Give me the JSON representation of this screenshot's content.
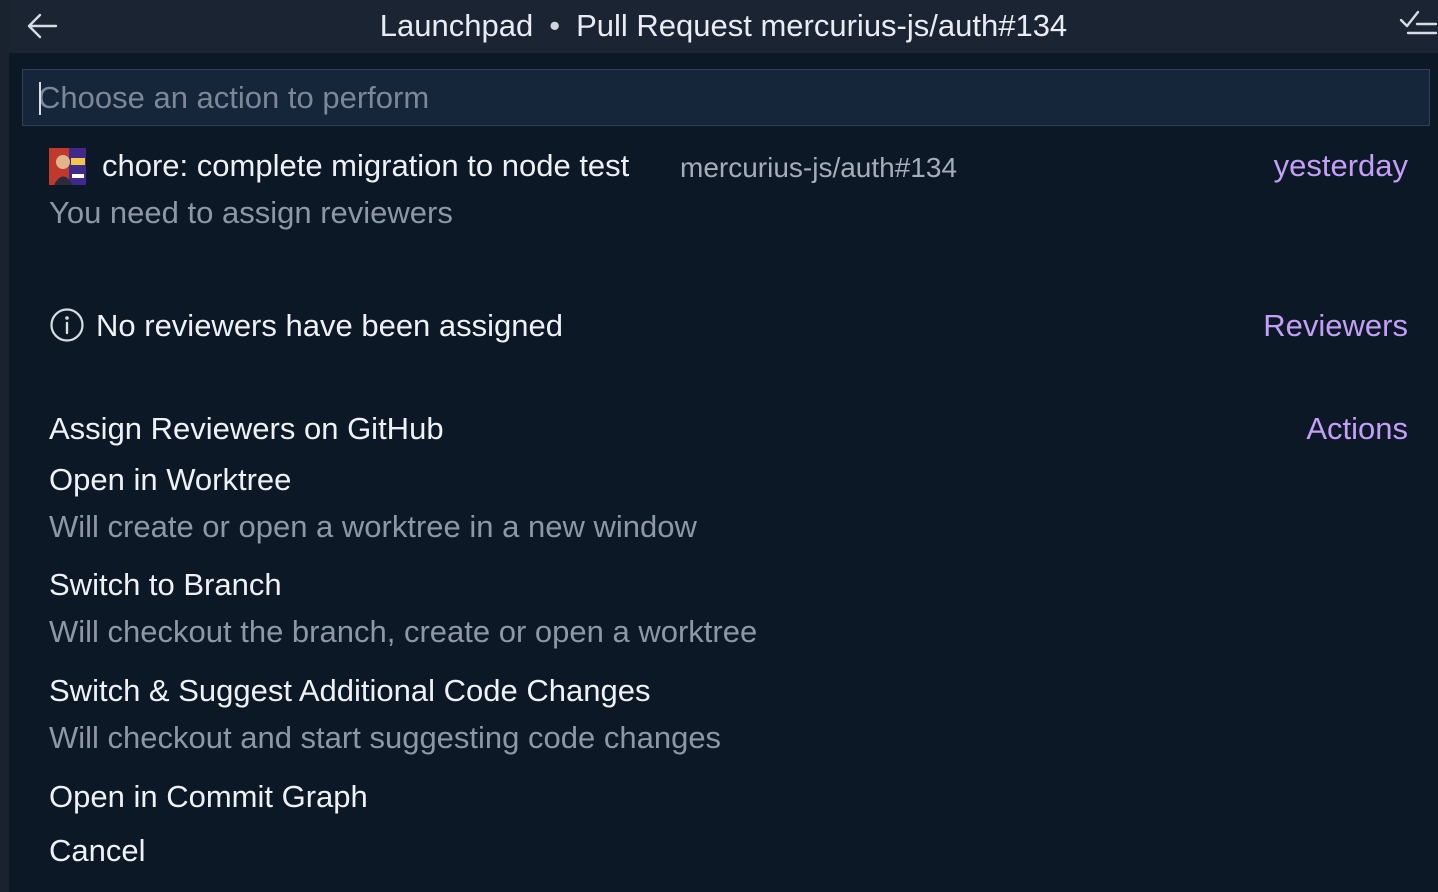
{
  "titlebar": {
    "title_left": "Launchpad",
    "separator": "•",
    "title_right": "Pull Request mercurius-js/auth#134",
    "back_icon": "arrow-left-icon",
    "right_icon": "check-all-icon"
  },
  "search": {
    "placeholder": "Choose an action to perform",
    "value": ""
  },
  "pull_request": {
    "title": "chore: complete migration to node test",
    "ref": "mercurius-js/auth#134",
    "time": "yesterday",
    "subtitle": "You need to assign reviewers",
    "avatar_icon": "user-avatar"
  },
  "info": {
    "icon": "info-circle-icon",
    "text": "No reviewers have been assigned",
    "tag": "Reviewers"
  },
  "actions": {
    "group_label": "Actions",
    "items": [
      {
        "title": "Assign Reviewers on GitHub",
        "subtitle": ""
      },
      {
        "title": "Open in Worktree",
        "subtitle": "Will create or open a worktree in a new window"
      },
      {
        "title": "Switch to Branch",
        "subtitle": "Will checkout the branch, create or open a worktree"
      },
      {
        "title": "Switch & Suggest Additional Code Changes",
        "subtitle": "Will checkout and start suggesting code changes"
      },
      {
        "title": "Open in Commit Graph",
        "subtitle": ""
      },
      {
        "title": "Cancel",
        "subtitle": ""
      }
    ]
  },
  "colors": {
    "background": "#0d1826",
    "titlebar": "#1b2433",
    "accent": "#c49ff7",
    "secondary_text": "#8d97a5"
  }
}
